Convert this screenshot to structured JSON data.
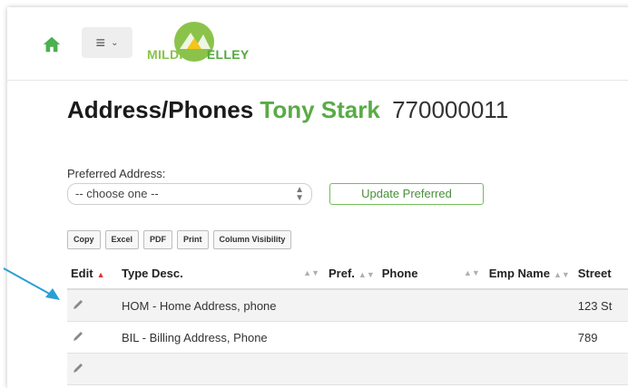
{
  "header": {
    "menu_icon": "hamburger-icon",
    "logo_text_a": "MILDRED",
    "logo_text_b": "ELLEY"
  },
  "page": {
    "title": "Address/Phones",
    "person_name": "Tony Stark",
    "person_id": "770000011"
  },
  "preferred": {
    "label": "Preferred Address:",
    "selected": "-- choose one --",
    "button": "Update Preferred"
  },
  "tools": [
    "Copy",
    "Excel",
    "PDF",
    "Print",
    "Column Visibility"
  ],
  "table": {
    "columns": [
      "Edit",
      "Type Desc.",
      "Pref.",
      "Phone",
      "Emp Name",
      "Street"
    ],
    "rows": [
      {
        "type": "HOM - Home Address, phone",
        "street": "123 St"
      },
      {
        "type": "BIL - Billing Address, Phone",
        "street": "789"
      }
    ]
  },
  "colors": {
    "accent": "#5aab47",
    "sort_active": "#dd3333",
    "annotation_arrow": "#2a9fd6"
  }
}
